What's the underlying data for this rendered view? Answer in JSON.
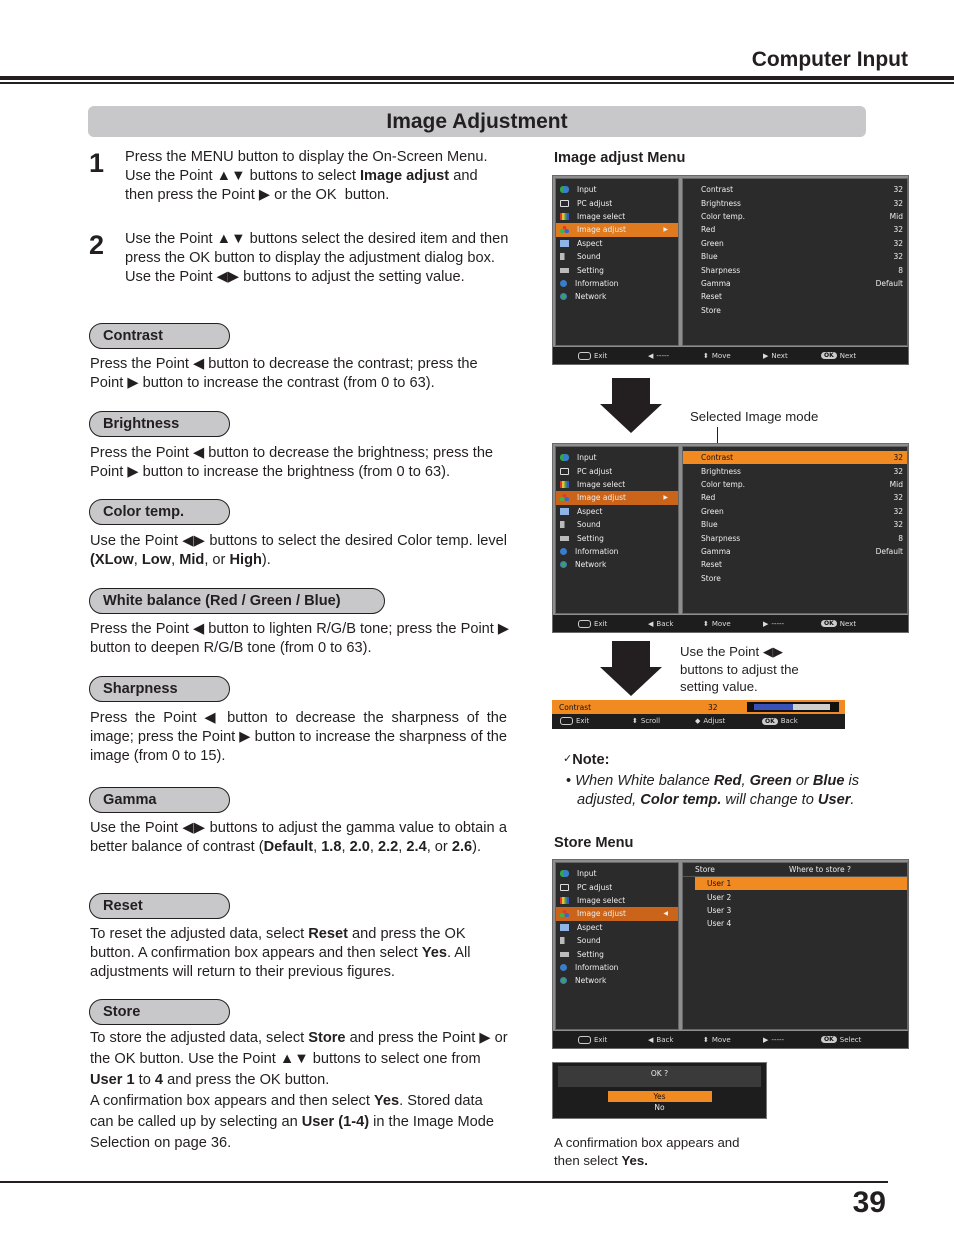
{
  "header": {
    "section_title": "Computer Input",
    "banner_title": "Image Adjustment"
  },
  "steps": [
    {
      "number": "1",
      "text_html": "Press the MENU button to display the On-Screen Menu. Use the Point ▲▼ buttons to select <b>Image adjust</b> and then press the Point ▶ or the OK&nbsp; button."
    },
    {
      "number": "2",
      "text_html": "Use the Point ▲▼ buttons select the desired item and then press the OK button to display the adjustment dialog box. Use the Point ◀▶ buttons to adjust the setting value."
    }
  ],
  "sections": [
    {
      "title": "Contrast",
      "text_html": "Press the Point ◀ button to decrease the contrast; press the Point ▶ button to increase the contrast (from 0 to 63)."
    },
    {
      "title": "Brightness",
      "text_html": "Press the Point ◀ button to decrease the brightness; press the Point ▶ button to increase the brightness (from 0 to 63)."
    },
    {
      "title": "Color temp.",
      "text_html": "Use the Point ◀▶ buttons to select the desired Color temp. level <b>(XLow</b>, <b>Low</b>, <b>Mid</b>, or <b>High</b>)."
    },
    {
      "title": "White balance (Red / Green / Blue)",
      "text_html": "Press the Point ◀ button to lighten R/G/B tone; press the Point ▶ button to deepen R/G/B tone (from 0 to 63)."
    },
    {
      "title": "Sharpness",
      "text_html": "Press the Point ◀ button to decrease the sharpness of the image; press the Point ▶ button to increase the sharpness of the image (from 0 to 15)."
    },
    {
      "title": "Gamma",
      "text_html": "Use the Point ◀▶ buttons to adjust the gamma value to obtain a better balance of contrast (<b>Default</b>, <b>1.8</b>, <b>2.0</b>, <b>2.2</b>, <b>2.4</b>, or <b>2.6</b>)."
    },
    {
      "title": "Reset",
      "text_html": "To reset the adjusted data, select <b>Reset</b> and press the OK button. A confirmation box appears and then select <b>Yes</b>. All adjustments will return to their previous figures."
    },
    {
      "title": "Store",
      "text_html": "To store the adjusted data, select <b>Store</b> and press the Point ▶ or the OK button. Use the Point ▲▼ buttons to select one from <b>User 1</b> to <b>4</b> and press the OK button.<br>A confirmation box appears and then select <b>Yes</b>. Stored data can be called up by selecting an <b>User (1-4)</b> in the Image Mode Selection on page 36."
    }
  ],
  "right": {
    "image_adjust_caption": "Image adjust Menu",
    "selected_mode_label": "Selected Image mode",
    "adjust_hint": "Use the Point ◀▶ buttons to adjust the setting value.",
    "note_title": "Note:",
    "note_text_html": "• <i>When White balance <b>Red</b>, <b>Green</b> or <b>Blue</b> is adjusted, <b>Color temp.</b> will change to <b>User</b>.</i>",
    "store_caption": "Store Menu",
    "confirm_caption_html": "A confirmation box appears and then select <b>Yes.</b>"
  },
  "osd": {
    "main_menu": [
      "Input",
      "PC adjust",
      "Image select",
      "Image adjust",
      "Aspect",
      "Sound",
      "Setting",
      "Information",
      "Network"
    ],
    "main_icons": [
      "input-icon",
      "pc-adjust-icon",
      "image-select-icon",
      "image-adjust-icon",
      "aspect-icon",
      "sound-icon",
      "setting-icon",
      "information-icon",
      "network-icon"
    ],
    "selected_main": "Image adjust",
    "adjust_items": [
      {
        "label": "Contrast",
        "value": "32"
      },
      {
        "label": "Brightness",
        "value": "32"
      },
      {
        "label": "Color temp.",
        "value": "Mid"
      },
      {
        "label": "Red",
        "value": "32"
      },
      {
        "label": "Green",
        "value": "32"
      },
      {
        "label": "Blue",
        "value": "32"
      },
      {
        "label": "Sharpness",
        "value": "8"
      },
      {
        "label": "Gamma",
        "value": "Default"
      },
      {
        "label": "Reset",
        "value": ""
      },
      {
        "label": "Store",
        "value": ""
      }
    ],
    "bottom1": {
      "exit": "Exit",
      "left": "-----",
      "move": "Move",
      "right": "Next",
      "ok": "OK",
      "ok_action": "Next"
    },
    "bottom2": {
      "exit": "Exit",
      "left": "Back",
      "move": "Move",
      "right": "-----",
      "ok": "OK",
      "ok_action": "Next"
    },
    "adjust_bar": {
      "label": "Contrast",
      "value": "32",
      "level_fraction": 0.51,
      "exit": "Exit",
      "scroll": "Scroll",
      "adjust": "Adjust",
      "ok": "OK",
      "ok_action": "Back"
    },
    "store_menu": {
      "title": "Store",
      "prompt": "Where to store ?",
      "items": [
        "User 1",
        "User 2",
        "User 3",
        "User 4"
      ],
      "selected": "User 1",
      "bottom": {
        "exit": "Exit",
        "left": "Back",
        "move": "Move",
        "right": "-----",
        "ok": "OK",
        "ok_action": "Select"
      }
    },
    "confirm": {
      "question": "OK ?",
      "options": [
        "Yes",
        "No"
      ],
      "selected": "Yes"
    }
  },
  "footer": {
    "page_number": "39"
  }
}
